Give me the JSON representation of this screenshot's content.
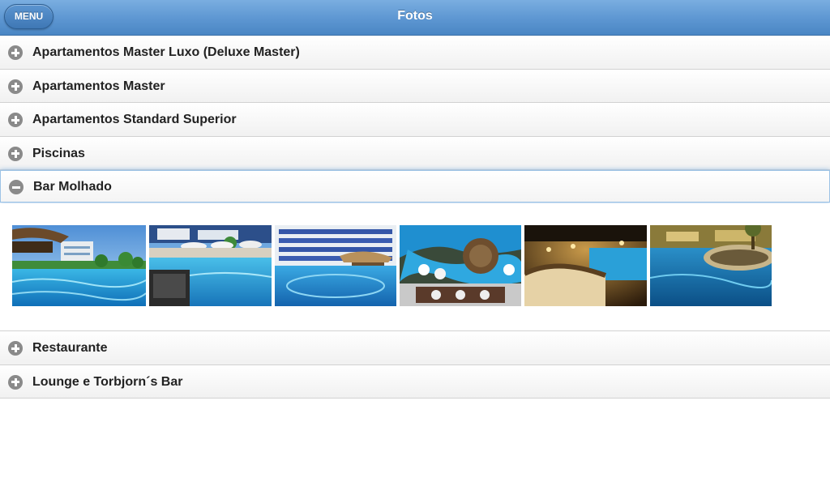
{
  "header": {
    "title": "Fotos",
    "menu_label": "MENU"
  },
  "sections": [
    {
      "label": "Apartamentos Master Luxo (Deluxe Master)",
      "expanded": false,
      "icon": "plus-icon"
    },
    {
      "label": "Apartamentos Master",
      "expanded": false,
      "icon": "plus-icon"
    },
    {
      "label": "Apartamentos Standard Superior",
      "expanded": false,
      "icon": "plus-icon"
    },
    {
      "label": "Piscinas",
      "expanded": false,
      "icon": "plus-icon"
    },
    {
      "label": "Bar Molhado",
      "expanded": true,
      "icon": "minus-icon"
    },
    {
      "label": "Restaurante",
      "expanded": false,
      "icon": "plus-icon"
    },
    {
      "label": "Lounge e Torbjorn´s Bar",
      "expanded": false,
      "icon": "plus-icon"
    }
  ],
  "gallery": {
    "photo_count": 6
  },
  "colors": {
    "header_top": "#7aaee0",
    "header_bottom": "#4a86c4",
    "expanded_border": "#9dc3e6",
    "icon_gray": "#8a8a8a",
    "pool_blue": "#2a9fd8"
  }
}
